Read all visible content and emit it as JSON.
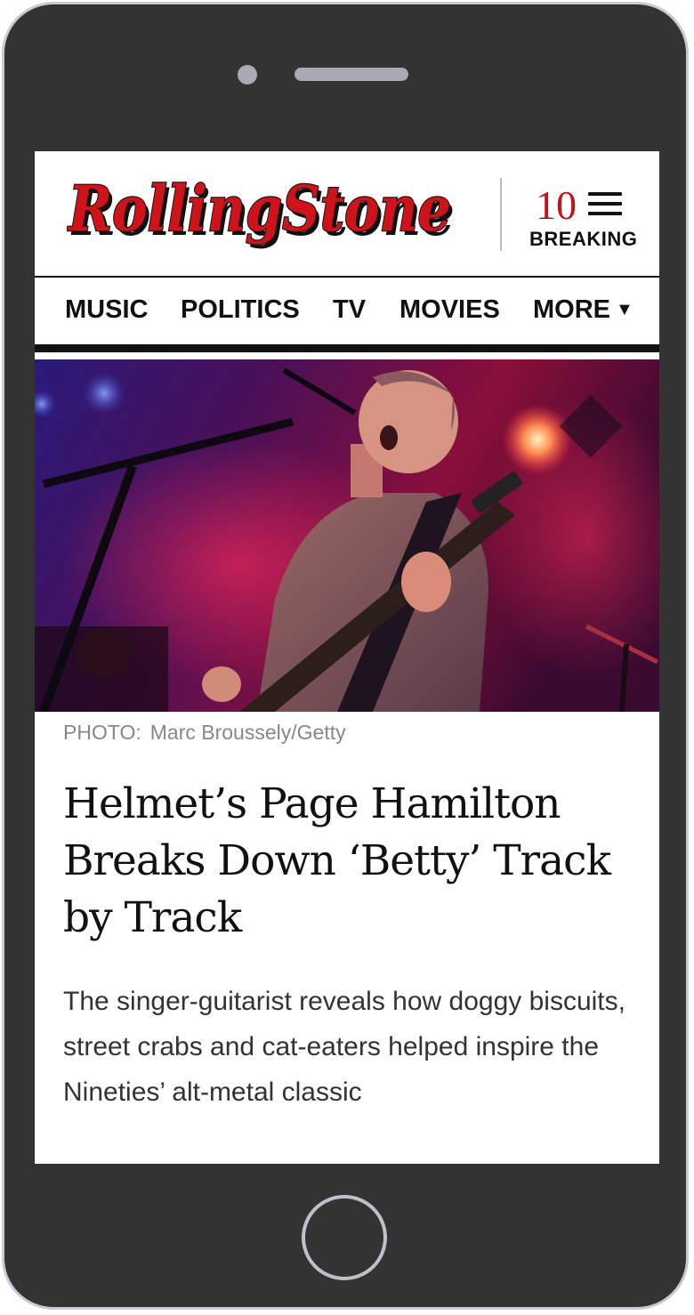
{
  "header": {
    "logo_text": "RollingStone",
    "breaking_count": "10",
    "breaking_label": "BREAKING"
  },
  "nav": {
    "items": [
      "MUSIC",
      "POLITICS",
      "TV",
      "MOVIES",
      "MORE"
    ]
  },
  "article": {
    "photo_label": "PHOTO:",
    "photo_credit": "Marc Broussely/Getty",
    "headline": "Helmet’s Page Hamilton Breaks Down ‘Betty’ Track by Track",
    "dek": "The singer-guitarist reveals how doggy biscuits, street crabs and cat-eaters helped inspire the Nineties’ alt-metal classic"
  },
  "colors": {
    "brand_red": "#d0131a",
    "bezel": "#333333",
    "caption_gray": "#888888"
  }
}
